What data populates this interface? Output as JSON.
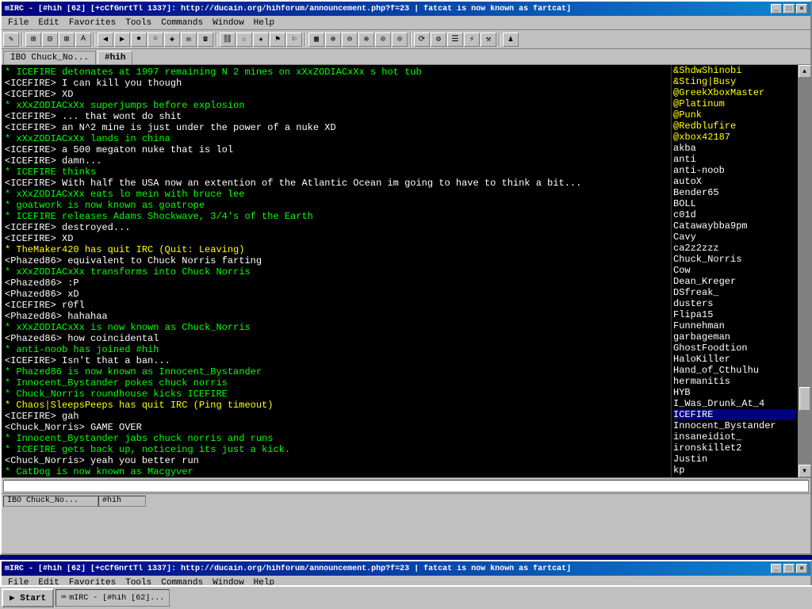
{
  "title_bar": {
    "label": "mIRC - [#hih [62] [+cCfGnrtTl 1337]: http://ducain.org/hihforum/announcement.php?f=23 | fatcat is now known as fartcat]",
    "minimize": "_",
    "maximize": "□",
    "close": "×"
  },
  "menu": {
    "items": [
      "File",
      "Edit",
      "Favorites",
      "Tools",
      "Commands",
      "Window",
      "Help"
    ]
  },
  "tabs": [
    {
      "label": "IBO Chuck_No..."
    },
    {
      "label": "#hih"
    }
  ],
  "chat_lines": [
    {
      "text": "* ICEFIRE detonates at 1997 remaining N 2 mines on xXxZODIACxXx s hot tub",
      "type": "action"
    },
    {
      "text": "<ICEFIRE> I can kill you though",
      "type": "normal"
    },
    {
      "text": "<ICEFIRE> XD",
      "type": "normal"
    },
    {
      "text": "* xXxZODIACxXx superjumps before explosion",
      "type": "action"
    },
    {
      "text": "<ICEFIRE> ... that wont do shit",
      "type": "normal"
    },
    {
      "text": "<ICEFIRE> an N^2 mine is just under the power of a nuke XD",
      "type": "normal"
    },
    {
      "text": "* xXxZODIACxXx lands in china",
      "type": "action"
    },
    {
      "text": "<ICEFIRE> a 500 megaton nuke that is lol",
      "type": "normal"
    },
    {
      "text": "<ICEFIRE> damn...",
      "type": "normal"
    },
    {
      "text": "* ICEFIRE thinks",
      "type": "action"
    },
    {
      "text": "<ICEFIRE> With half the USA now an extention of the Atlantic Ocean im going to have to think a bit...",
      "type": "normal"
    },
    {
      "text": "* xXxZODIACxXx eats lo mein with bruce lee",
      "type": "action"
    },
    {
      "text": "* goatwork is now known as goatrope",
      "type": "action"
    },
    {
      "text": "* ICEFIRE releases Adams Shockwave, 3/4's of the Earth",
      "type": "action"
    },
    {
      "text": "<ICEFIRE> destroyed...",
      "type": "normal"
    },
    {
      "text": "<ICEFIRE> XD",
      "type": "normal"
    },
    {
      "text": "* TheMaker420 has quit IRC (Quit: Leaving)",
      "type": "system"
    },
    {
      "text": "<Phazed86> equivalent to Chuck Norris farting",
      "type": "normal"
    },
    {
      "text": "* xXxZODIACxXx transforms into Chuck Norris",
      "type": "action"
    },
    {
      "text": "<Phazed86> :P",
      "type": "normal"
    },
    {
      "text": "<Phazed86> xD",
      "type": "normal"
    },
    {
      "text": "<ICEFIRE> r0fl",
      "type": "normal"
    },
    {
      "text": "<Phazed86> hahahaa",
      "type": "normal"
    },
    {
      "text": "* xXxZODIACxXx is now known as Chuck_Norris",
      "type": "action"
    },
    {
      "text": "<Phazed86> how coincidental",
      "type": "normal"
    },
    {
      "text": "* anti-noob has joined #hih",
      "type": "action"
    },
    {
      "text": "<ICEFIRE> Isn't that a ban...",
      "type": "normal"
    },
    {
      "text": "* Phazed86 is now known as Innocent_Bystander",
      "type": "action"
    },
    {
      "text": "* Innocent_Bystander pokes chuck norris",
      "type": "action"
    },
    {
      "text": "* Chuck_Norris roundhouse kicks ICEFIRE",
      "type": "action"
    },
    {
      "text": "* Chaos|SleepsPeeps has quit IRC (Ping timeout)",
      "type": "system"
    },
    {
      "text": "<ICEFIRE> gah",
      "type": "normal"
    },
    {
      "text": "<Chuck_Norris> GAME OVER",
      "type": "normal"
    },
    {
      "text": "* Innocent_Bystander jabs chuck norris and runs",
      "type": "action"
    },
    {
      "text": "* ICEFIRE gets back up, noticeing its just a kick.",
      "type": "action"
    },
    {
      "text": "<Chuck_Norris> yeah you better run",
      "type": "normal"
    },
    {
      "text": "* CatDog is now known as Macgyver",
      "type": "action"
    }
  ],
  "nick_list": [
    {
      "name": "&ShdwShinobi",
      "type": "op"
    },
    {
      "name": "&Sting|Busy",
      "type": "op"
    },
    {
      "name": "@GreekXboxMaster",
      "type": "op"
    },
    {
      "name": "@Platinum",
      "type": "op"
    },
    {
      "name": "@Punk",
      "type": "op"
    },
    {
      "name": "@Redblufire",
      "type": "op"
    },
    {
      "name": "@xbox42187",
      "type": "op"
    },
    {
      "name": "akba",
      "type": "normal"
    },
    {
      "name": "anti",
      "type": "normal"
    },
    {
      "name": "anti-noob",
      "type": "normal"
    },
    {
      "name": "autoX",
      "type": "normal"
    },
    {
      "name": "Bender65",
      "type": "normal"
    },
    {
      "name": "BOLL",
      "type": "normal"
    },
    {
      "name": "c01d",
      "type": "normal"
    },
    {
      "name": "Catawaybba9pm",
      "type": "normal"
    },
    {
      "name": "Cavy",
      "type": "normal"
    },
    {
      "name": "ca2z2zzz",
      "type": "normal"
    },
    {
      "name": "Chuck_Norris",
      "type": "normal"
    },
    {
      "name": "Cow",
      "type": "normal"
    },
    {
      "name": "Dean_Kreger",
      "type": "normal"
    },
    {
      "name": "DSfreak_",
      "type": "normal"
    },
    {
      "name": "dusters",
      "type": "normal"
    },
    {
      "name": "Flipa15",
      "type": "normal"
    },
    {
      "name": "Funnehman",
      "type": "normal"
    },
    {
      "name": "garbageman",
      "type": "normal"
    },
    {
      "name": "GhostFoodtion",
      "type": "normal"
    },
    {
      "name": "HaloKiller",
      "type": "normal"
    },
    {
      "name": "Hand_of_Cthulhu",
      "type": "normal"
    },
    {
      "name": "hermanitis",
      "type": "normal"
    },
    {
      "name": "HYB",
      "type": "normal"
    },
    {
      "name": "I_Was_Drunk_At_4",
      "type": "normal"
    },
    {
      "name": "ICEFIRE",
      "type": "highlighted"
    },
    {
      "name": "Innocent_Bystander",
      "type": "normal"
    },
    {
      "name": "insaneidiot_",
      "type": "normal"
    },
    {
      "name": "ironskillet2",
      "type": "normal"
    },
    {
      "name": "Justin",
      "type": "normal"
    },
    {
      "name": "kp",
      "type": "normal"
    }
  ],
  "status_bar": {
    "channel": "IBO Chuck_No...",
    "active_tab": "#hih"
  },
  "bottom_window": {
    "title": "mIRC - [#hih [62] [+cCfGnrtTl 1337]: http://ducain.org/hihforum/announcement.php?f=23 | fatcat is now known as fartcat]",
    "menu_items": [
      "File",
      "Edit",
      "Favorites",
      "Tools",
      "Commands",
      "Window",
      "Help"
    ]
  }
}
